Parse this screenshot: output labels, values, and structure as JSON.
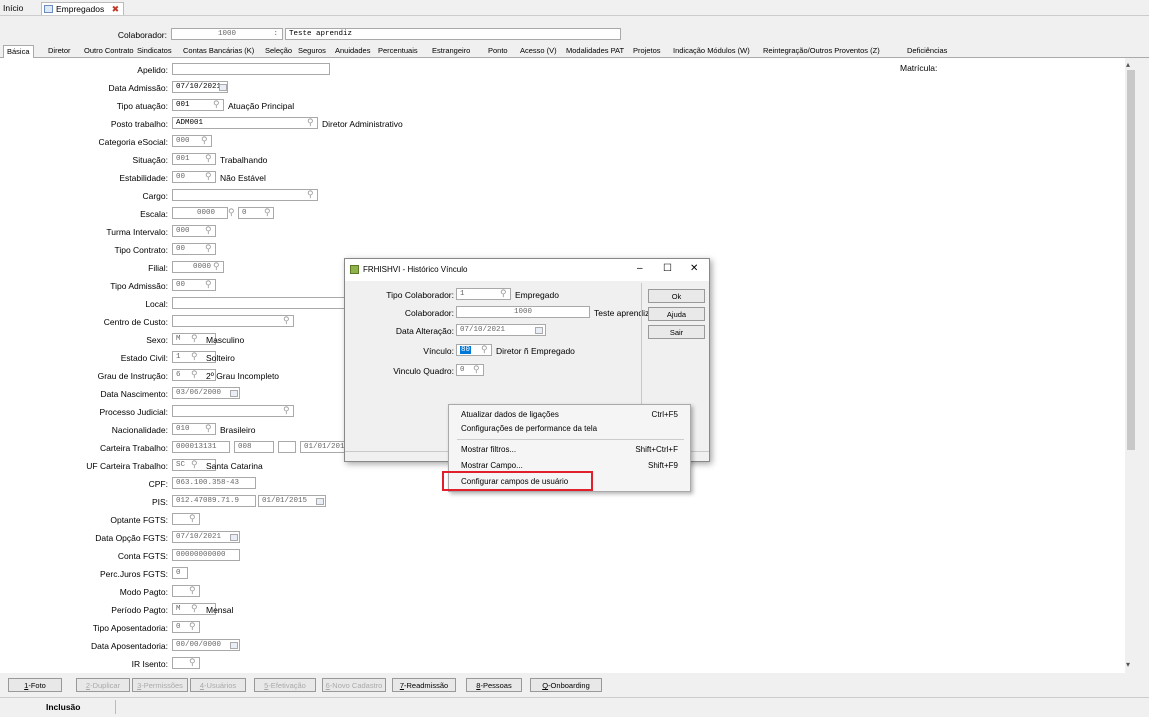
{
  "top_tabs": {
    "inicio": "Início",
    "empregados": "Empregados"
  },
  "header": {
    "colab_label": "Colaborador:",
    "colab_code": "1000",
    "colab_name": "Teste aprendiz"
  },
  "tabs": [
    "Básica",
    "Diretor",
    "Outro Contrato",
    "Sindicatos",
    "Contas Bancárias (K)",
    "Seleção",
    "Seguros",
    "Anuidades",
    "Percentuais",
    "Estrangeiro",
    "Ponto",
    "Acesso (V)",
    "Modalidades PAT",
    "Projetos",
    "Indicação Módulos (W)",
    "Reintegração/Outros Proventos (Z)",
    "Deficiências"
  ],
  "matricula_label": "Matrícula:",
  "form": {
    "apelido": {
      "label": "Apelido:"
    },
    "data_admissao": {
      "label": "Data Admissão:",
      "value": "07/10/2021"
    },
    "tipo_atuacao": {
      "label": "Tipo atuação:",
      "value": "001",
      "desc": "Atuação Principal"
    },
    "posto_trabalho": {
      "label": "Posto trabalho:",
      "value": "ADM001",
      "desc": "Diretor Administrativo"
    },
    "categoria_esocial": {
      "label": "Categoria eSocial:",
      "value": "000"
    },
    "situacao": {
      "label": "Situação:",
      "value": "001",
      "desc": "Trabalhando"
    },
    "estabilidade": {
      "label": "Estabilidade:",
      "value": "00",
      "desc": "Não Estável"
    },
    "cargo": {
      "label": "Cargo:"
    },
    "escala": {
      "label": "Escala:",
      "value": "0000",
      "value2": "0"
    },
    "turma_intervalo": {
      "label": "Turma Intervalo:",
      "value": "000"
    },
    "tipo_contrato": {
      "label": "Tipo Contrato:",
      "value": "00"
    },
    "filial": {
      "label": "Filial:",
      "value": "0000"
    },
    "tipo_admissao": {
      "label": "Tipo Admissão:",
      "value": "00"
    },
    "local": {
      "label": "Local:"
    },
    "centro_custo": {
      "label": "Centro de Custo:"
    },
    "sexo": {
      "label": "Sexo:",
      "value": "M",
      "desc": "Masculino"
    },
    "estado_civil": {
      "label": "Estado Civil:",
      "value": "1",
      "desc": "Solteiro"
    },
    "grau_instrucao": {
      "label": "Grau de Instrução:",
      "value": "6",
      "desc": "2º Grau Incompleto"
    },
    "data_nascimento": {
      "label": "Data Nascimento:",
      "value": "03/06/2000"
    },
    "processo_judicial": {
      "label": "Processo Judicial:"
    },
    "nacionalidade": {
      "label": "Nacionalidade:",
      "value": "010",
      "desc": "Brasileiro"
    },
    "carteira_trabalho": {
      "label": "Carteira Trabalho:",
      "value": "000013131",
      "serie": "008",
      "data": "01/01/2015"
    },
    "uf_carteira": {
      "label": "UF Carteira Trabalho:",
      "value": "SC",
      "desc": "Santa Catarina"
    },
    "cpf": {
      "label": "CPF:",
      "value": "063.100.358-43"
    },
    "pis": {
      "label": "PIS:",
      "value": "012.47089.71.9",
      "data": "01/01/2015"
    },
    "optante_fgts": {
      "label": "Optante FGTS:"
    },
    "data_opcao_fgts": {
      "label": "Data Opção FGTS:",
      "value": "07/10/2021"
    },
    "conta_fgts": {
      "label": "Conta FGTS:",
      "value": "00000000000"
    },
    "perc_juros_fgts": {
      "label": "Perc.Juros FGTS:",
      "value": "0"
    },
    "modo_pagto": {
      "label": "Modo Pagto:"
    },
    "periodo_pagto": {
      "label": "Período Pagto:",
      "value": "M",
      "desc": "Mensal"
    },
    "tipo_aposentadoria": {
      "label": "Tipo Aposentadoria:",
      "value": "0"
    },
    "data_aposentadoria": {
      "label": "Data Aposentadoria:",
      "value": "00/00/0000"
    },
    "ir_isento": {
      "label": "IR Isento:"
    }
  },
  "dialog": {
    "title": "FRHISHVI - Histórico Vínculo",
    "tipo_colab": {
      "label": "Tipo Colaborador:",
      "value": "1",
      "desc": "Empregado"
    },
    "colab": {
      "label": "Colaborador:",
      "value": "1000",
      "desc": "Teste aprendiz"
    },
    "data_alt": {
      "label": "Data Alteração:",
      "value": "07/10/2021"
    },
    "vinculo": {
      "label": "Vínculo:",
      "value": "80",
      "desc": "Diretor ñ Empregado"
    },
    "vinculo_quadro": {
      "label": "Vinculo Quadro:",
      "value": "0"
    },
    "btn_ok": "Ok",
    "btn_ajuda": "Ajuda",
    "btn_sair": "Sair",
    "min": "–",
    "max": "☐",
    "close": "✕"
  },
  "context_menu": [
    {
      "label": "Atualizar dados de ligações",
      "shortcut": "Ctrl+F5"
    },
    {
      "label": "Configurações de performance da tela",
      "shortcut": ""
    },
    {
      "label": "Mostrar filtros...",
      "shortcut": "Shift+Ctrl+F"
    },
    {
      "label": "Mostrar Campo...",
      "shortcut": "Shift+F9"
    },
    {
      "label": "Configurar campos de usuário",
      "shortcut": ""
    }
  ],
  "bottom_buttons": [
    {
      "label": "1-Foto",
      "enabled": true
    },
    {
      "label": "2-Duplicar",
      "enabled": false
    },
    {
      "label": "3-Permissões",
      "enabled": false
    },
    {
      "label": "4-Usuários",
      "enabled": false
    },
    {
      "label": "5-Efetivação",
      "enabled": false
    },
    {
      "label": "6-Novo Cadastro",
      "enabled": false
    },
    {
      "label": "7-Readmissão",
      "enabled": true
    },
    {
      "label": "8-Pessoas",
      "enabled": true
    },
    {
      "label": "Q-Onboarding",
      "enabled": true
    }
  ],
  "status": "Inclusão",
  "colors": {
    "highlight": "#e0202a",
    "selection": "#0078d7"
  }
}
